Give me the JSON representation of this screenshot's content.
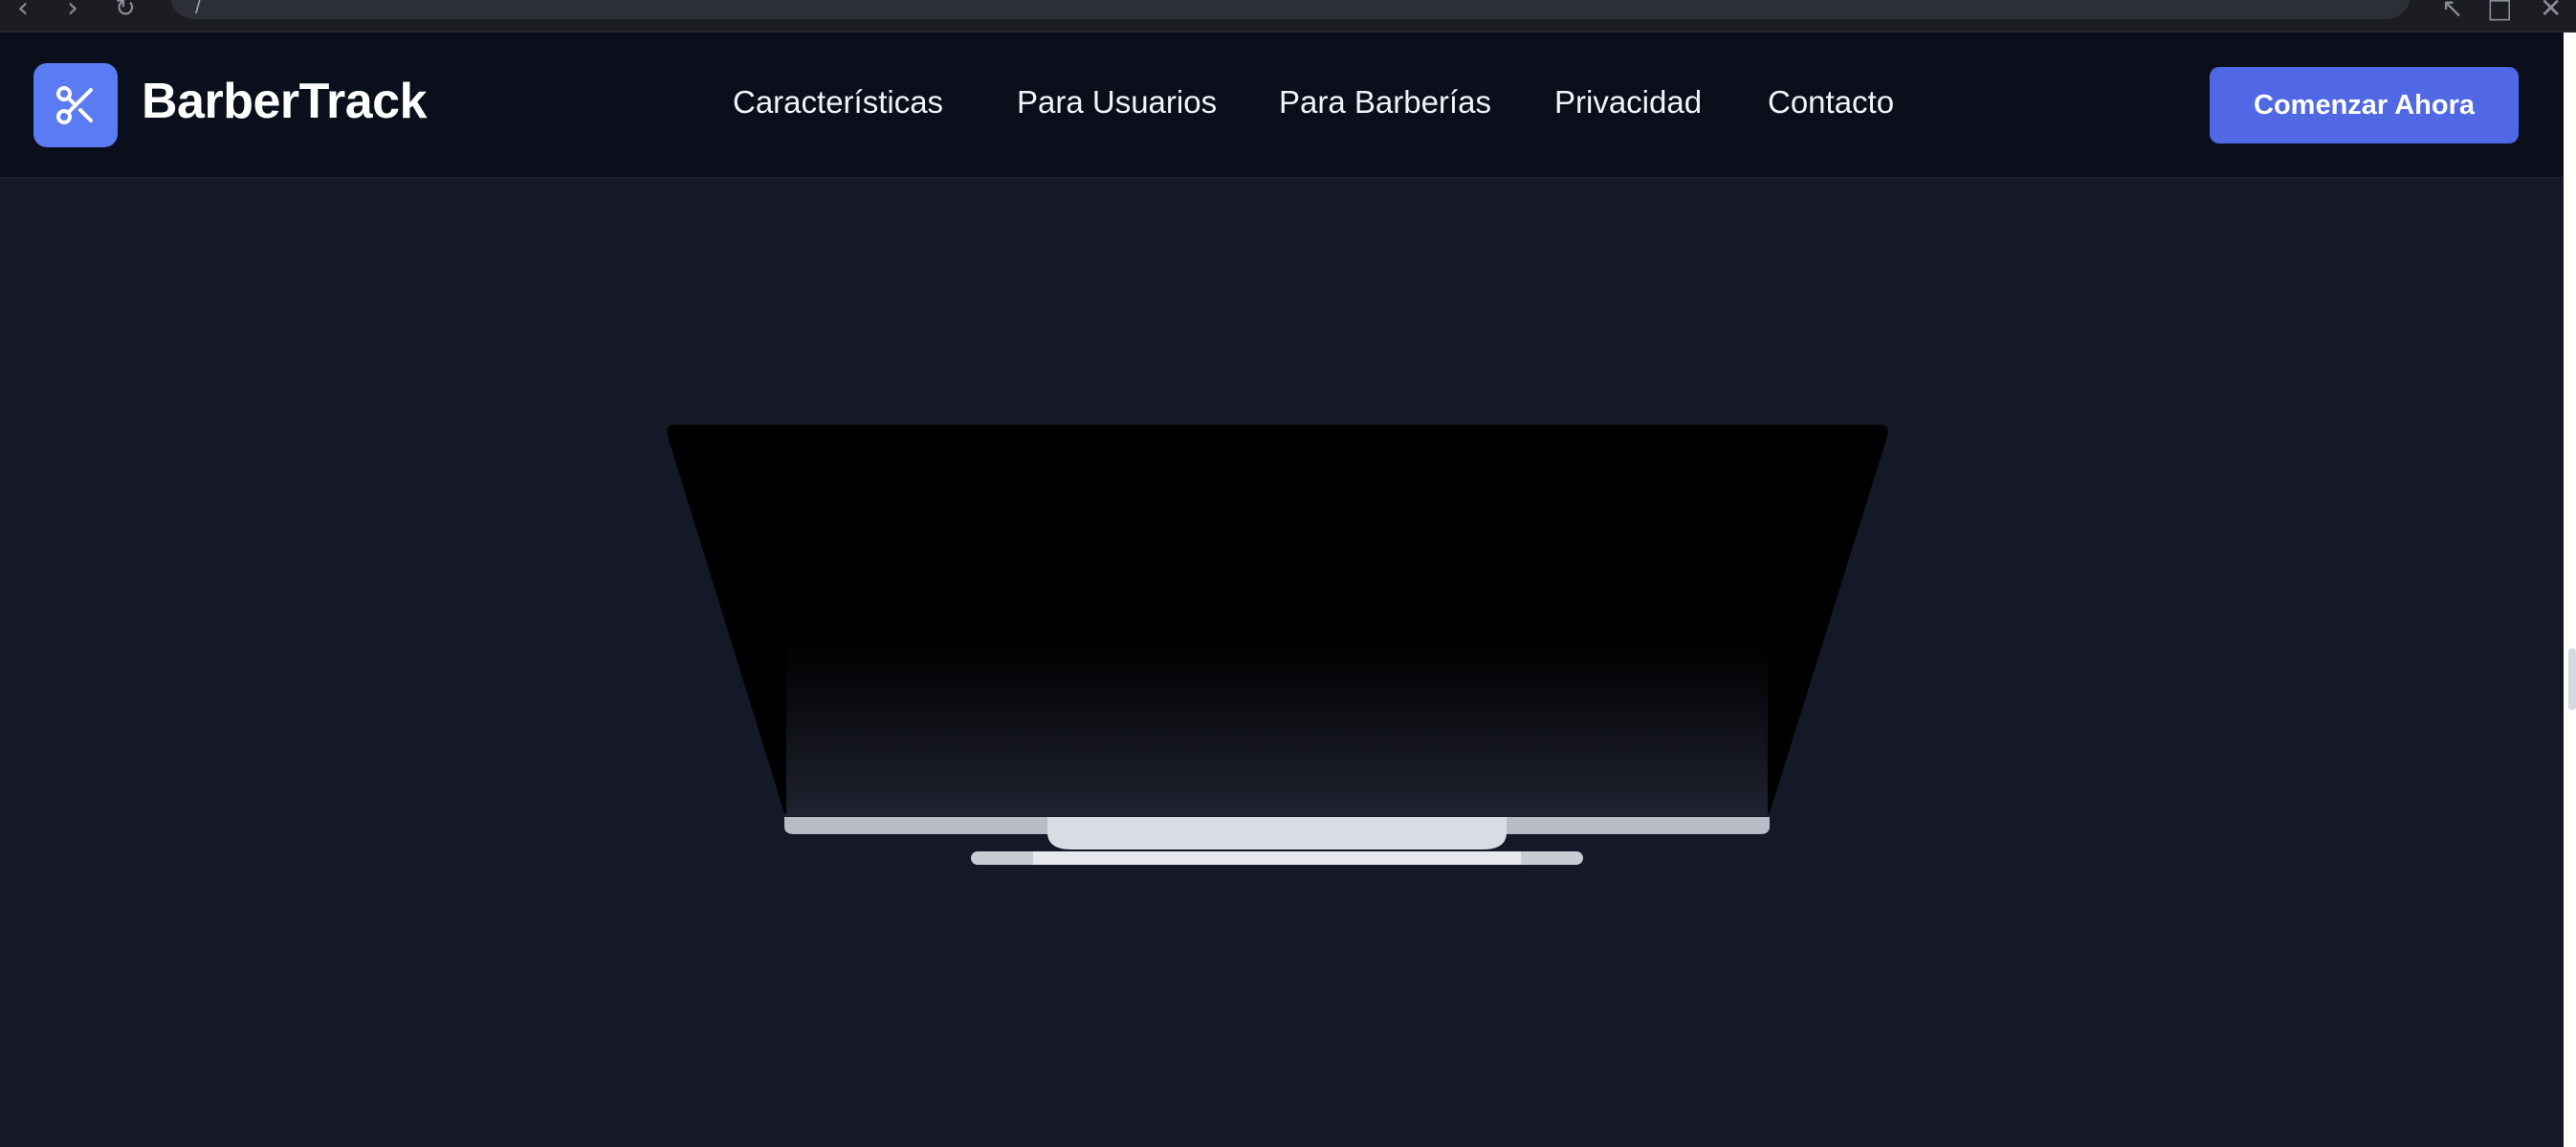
{
  "browser": {
    "address_text": "​/",
    "back_icon": "chevron-left-icon",
    "forward_icon": "chevron-right-icon",
    "reload_icon": "reload-icon"
  },
  "header": {
    "brand": "BarberTrack",
    "logo_icon": "scissors-icon",
    "nav": {
      "features": "Características",
      "users": "Para Usuarios",
      "barbershops": "Para Barberías",
      "privacy": "Privacidad",
      "contact": "Contacto"
    },
    "cta_label": "Comenzar Ahora"
  },
  "colors": {
    "background": "#151827",
    "header_background": "#0b0e1b",
    "accent": "#5068e4",
    "logo_background": "#5b7bf2"
  }
}
